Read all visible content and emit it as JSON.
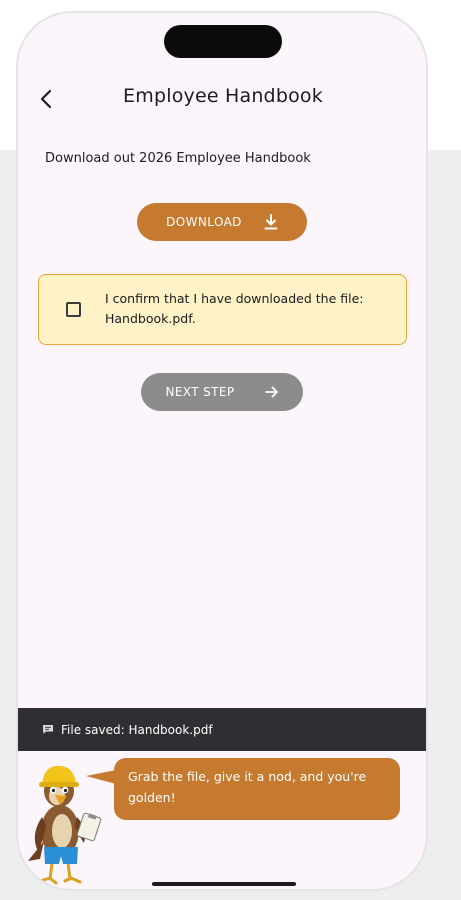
{
  "header": {
    "title": "Employee Handbook",
    "back_icon": "arrow-back-icon"
  },
  "intro": {
    "text": "Download out 2026 Employee Handbook"
  },
  "download": {
    "label": "DOWNLOAD",
    "icon": "download-icon"
  },
  "confirmation": {
    "checked": false,
    "text": "I confirm that I have downloaded the file: Handbook.pdf."
  },
  "next": {
    "label": "NEXT STEP",
    "icon": "arrow-forward-icon",
    "enabled": false
  },
  "snackbar": {
    "text": "File saved: Handbook.pdf",
    "icon": "chat-icon"
  },
  "assistant": {
    "message": "Grab the file, give it a nod, and you're golden!",
    "mascot": "hawk-mascot-with-hard-hat"
  },
  "colors": {
    "accent": "#c57a2f",
    "confirm_bg": "#fdf3c6",
    "confirm_border": "#eea636",
    "disabled_button": "#8c8c8c",
    "snackbar_bg": "#2f2f33",
    "screen_bg": "#fcf5fc"
  }
}
